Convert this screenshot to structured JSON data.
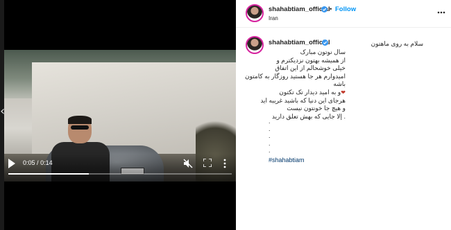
{
  "post": {
    "username": "shahabtiam_official",
    "follow_label": "Follow",
    "separator": "•",
    "location": "Iran",
    "caption_lines": [
      "سلام به روی ماهتون",
      "سال نوتون مبارک",
      "از همیشه بهتون نزدیکترم و",
      "خیلی خوشحالم از این اتفاق",
      "امیدوارم هر جا هستید روزگار به کامتون باشه",
      "و به امید دیدار تک تکتون",
      "هرجای این دنیا که باشید غریبه اید",
      "و هیچ جا خونتون نیست",
      ". إلا جایی که بهش تعلق دارید",
      ".",
      ".",
      ".",
      ".",
      "."
    ],
    "heart_emoji": "❤",
    "hashtag": "#shahabtiam"
  },
  "video": {
    "current_time": "0:05",
    "time_separator": "/",
    "duration": "0:14",
    "progress": 0.36
  },
  "icons": {
    "side_arrow": "chevron-left-icon",
    "play": "play-icon",
    "mute": "muted-speaker-icon",
    "fullscreen": "fullscreen-icon",
    "more_video": "vertical-dots-icon",
    "more_post": "horizontal-dots-icon",
    "verified": "verified-badge-icon"
  },
  "colors": {
    "follow_blue": "#0095f6",
    "verified_blue": "#3897f0",
    "hashtag": "#00376b",
    "story_ring": "#d6249f"
  }
}
